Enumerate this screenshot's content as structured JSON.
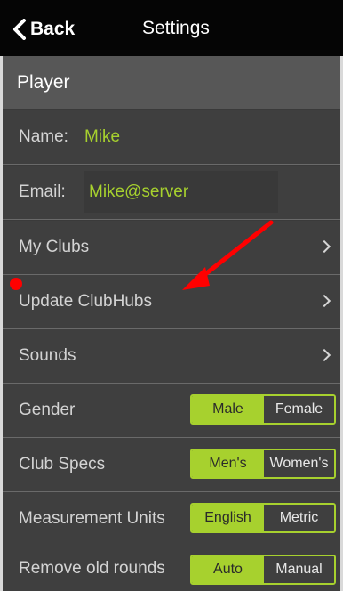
{
  "header": {
    "back_label": "Back",
    "title": "Settings"
  },
  "section": {
    "player_title": "Player"
  },
  "rows": {
    "name": {
      "label": "Name:",
      "value": "Mike"
    },
    "email": {
      "label": "Email:",
      "value": "Mike@server"
    },
    "my_clubs": {
      "label": "My Clubs"
    },
    "update_clubhubs": {
      "label": "Update ClubHubs"
    },
    "sounds": {
      "label": "Sounds"
    },
    "gender": {
      "label": "Gender",
      "options": [
        "Male",
        "Female"
      ],
      "selected": "Male"
    },
    "club_specs": {
      "label": "Club Specs",
      "options": [
        "Men's",
        "Women's"
      ],
      "selected": "Men's"
    },
    "measurement_units": {
      "label": "Measurement Units",
      "options": [
        "English",
        "Metric"
      ],
      "selected": "English"
    },
    "remove_old_rounds": {
      "label": "Remove old rounds",
      "options": [
        "Auto",
        "Manual"
      ],
      "selected": "Auto"
    }
  },
  "colors": {
    "accent": "#a7d12e",
    "arrow": "#ff0000"
  }
}
